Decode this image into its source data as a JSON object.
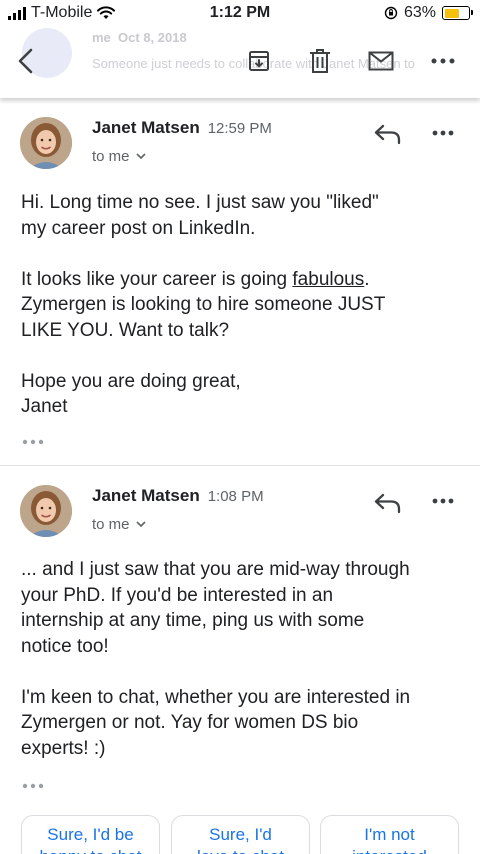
{
  "status_bar": {
    "carrier": "T-Mobile",
    "time": "1:12 PM",
    "battery": "63%",
    "battery_level": 0.63
  },
  "toolbar": {
    "ghost_sender": "me",
    "ghost_date": "Oct 8, 2018",
    "ghost_snippet": "Someone just needs to collaborate with Janet Matsen to"
  },
  "messages": [
    {
      "sender": "Janet Matsen",
      "time": "12:59 PM",
      "recipient": "to me",
      "body": {
        "p1": [
          "Hi.  Long time no see.  I just saw you \"liked\"",
          "my career post on LinkedIn."
        ],
        "p2_line1_pre": "It looks like your career is going ",
        "p2_line1_link": "fabulous",
        "p2_line1_post": ".",
        "p2_line2": "Zymergen is looking to hire someone JUST",
        "p2_line3": "LIKE YOU.  Want to talk?",
        "p3": [
          "Hope you are doing great,",
          "Janet"
        ]
      }
    },
    {
      "sender": "Janet Matsen",
      "time": "1:08 PM",
      "recipient": "to me",
      "body": {
        "p1": [
          "... and I just saw that you are mid-way through",
          "your PhD.   If you'd be interested in an",
          "internship at any time, ping us with some",
          "notice too!"
        ],
        "p2": [
          "I'm keen to chat, whether you are interested in",
          "Zymergen or not.  Yay for women DS bio",
          "experts!  :)"
        ]
      }
    }
  ],
  "smart_replies": [
    {
      "line1": "Sure, I'd be",
      "line2": "happy to chat"
    },
    {
      "line1": "Sure, I'd",
      "line2": "love to chat"
    },
    {
      "line1": "I'm not",
      "line2": "interested"
    }
  ],
  "colors": {
    "accent": "#1a73e8",
    "battery": "#f4c20d",
    "secondary_text": "#5f6368"
  },
  "icons": [
    "back-arrow-icon",
    "archive-icon",
    "trash-icon",
    "mail-icon",
    "more-icon",
    "reply-icon",
    "chevron-down-icon",
    "ellipsis-icon"
  ]
}
